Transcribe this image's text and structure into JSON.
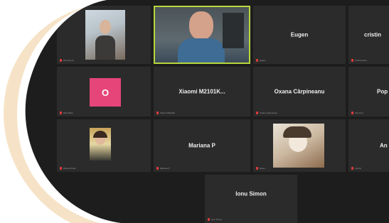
{
  "tiles": [
    {
      "key": "t1",
      "name": "",
      "footer": "Ramona D."
    },
    {
      "key": "t2",
      "name": "",
      "footer": ""
    },
    {
      "key": "t3",
      "name": "Eugen",
      "footer": "Eugen"
    },
    {
      "key": "t4",
      "name": "cristin",
      "footer": "cristina dima"
    },
    {
      "key": "t5",
      "name": "",
      "footer": "Maj Tataru"
    },
    {
      "key": "t6",
      "name": "Xiaomi  M2101K...",
      "footer": "Xiaomi M2101K"
    },
    {
      "key": "t7",
      "name": "Oxana Cârpineanu",
      "footer": "Oxana Carpineanu"
    },
    {
      "key": "t8",
      "name": "Pop",
      "footer": "Pop Pop"
    },
    {
      "key": "t9",
      "name": "",
      "footer": "Diana Pintea"
    },
    {
      "key": "t10",
      "name": "Mariana P",
      "footer": "Mariana P"
    },
    {
      "key": "t11",
      "name": "",
      "footer": "Dana ..."
    },
    {
      "key": "t12",
      "name": "An",
      "footer": "Ana M"
    },
    {
      "key": "t13",
      "name": "Ionu Simon",
      "footer": "Ionu Simon"
    }
  ],
  "avatar_initial": "O",
  "colors": {
    "active_border": "#b8d63a",
    "avatar_pink": "#e6457a",
    "mic_red": "#e23b3b",
    "deco_peach": "#f6e3c7"
  }
}
